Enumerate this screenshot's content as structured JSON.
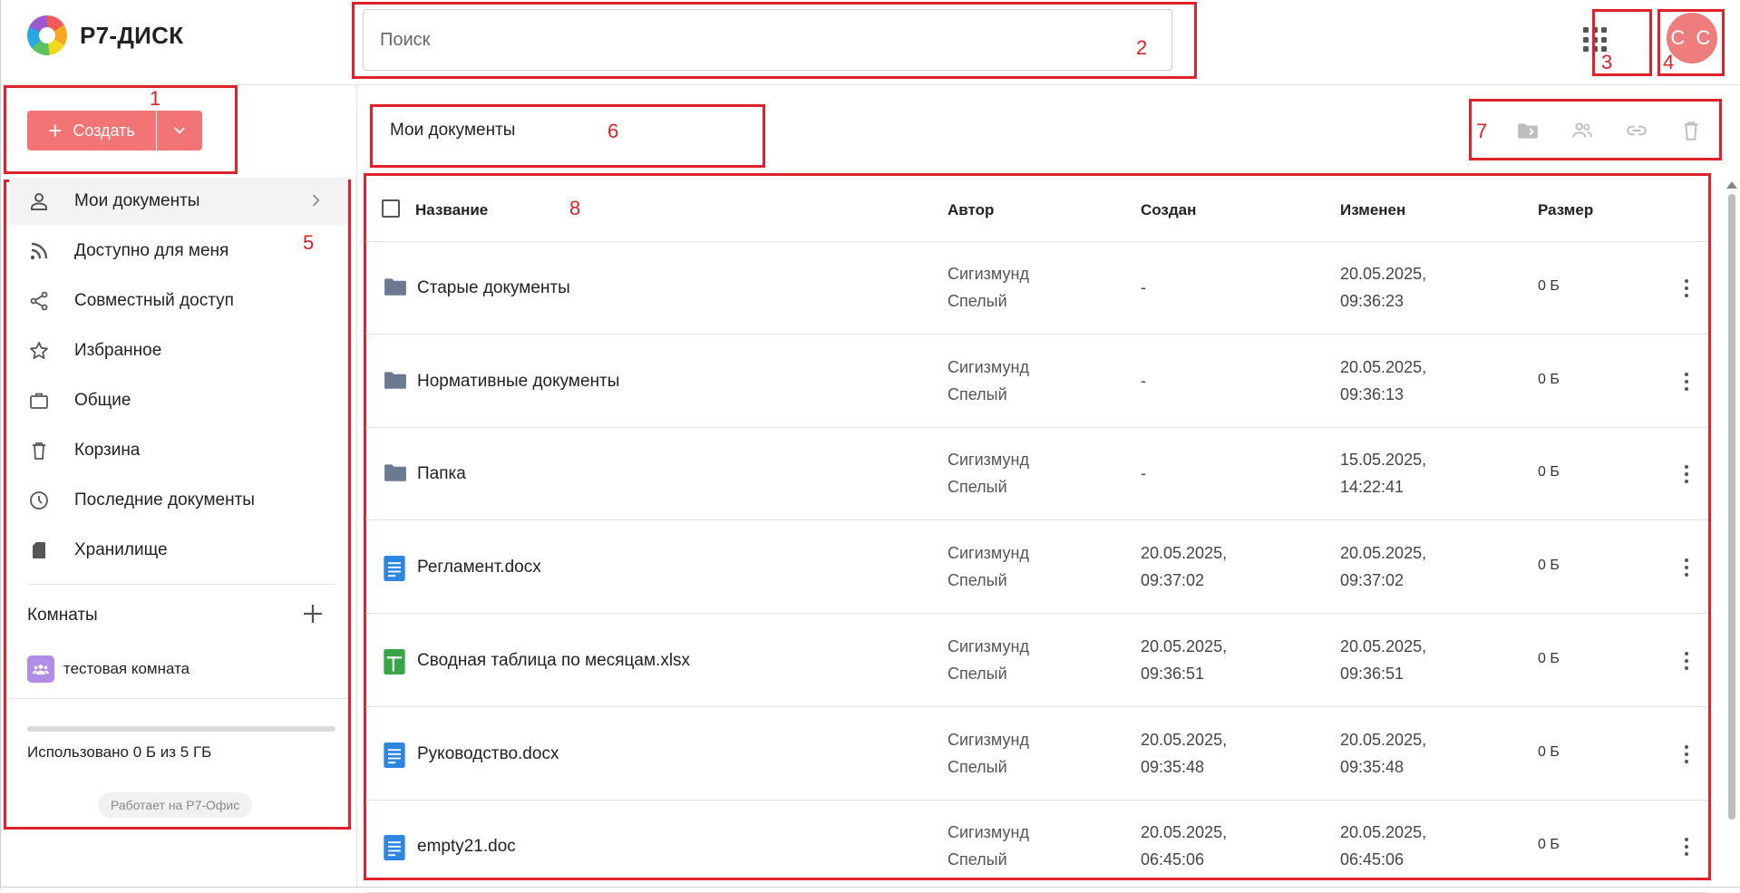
{
  "header": {
    "brand": "Р7-ДИСК",
    "search_placeholder": "Поиск",
    "avatar_initials": "С С",
    "apps_icon": "apps-grid-icon"
  },
  "annotations": [
    "1",
    "2",
    "3",
    "4",
    "5",
    "6",
    "7",
    "8"
  ],
  "create": {
    "label": "Создать"
  },
  "sidebar": {
    "items": [
      {
        "label": "Мои документы",
        "icon": "person-icon"
      },
      {
        "label": "Доступно для меня",
        "icon": "rss-icon"
      },
      {
        "label": "Совместный доступ",
        "icon": "share-icon"
      },
      {
        "label": "Избранное",
        "icon": "star-icon"
      },
      {
        "label": "Общие",
        "icon": "briefcase-icon"
      },
      {
        "label": "Корзина",
        "icon": "trash-icon"
      },
      {
        "label": "Последние документы",
        "icon": "clock-icon"
      },
      {
        "label": "Хранилище",
        "icon": "sd-card-icon"
      }
    ],
    "rooms_title": "Комнаты",
    "rooms": [
      {
        "label": "тестовая комната"
      }
    ],
    "quota": "Использовано 0 Б из 5 ГБ",
    "powered_by": "Работает на Р7-Офис"
  },
  "main": {
    "title": "Мои документы",
    "columns": {
      "name": "Название",
      "author": "Автор",
      "created": "Создан",
      "modified": "Изменен",
      "size": "Размер"
    },
    "rows": [
      {
        "type": "folder",
        "name": "Старые документы",
        "author1": "Сигизмунд",
        "author2": "Спелый",
        "created1": "-",
        "created2": "",
        "modified1": "20.05.2025,",
        "modified2": "09:36:23",
        "size": "0 Б"
      },
      {
        "type": "folder",
        "name": "Нормативные документы",
        "author1": "Сигизмунд",
        "author2": "Спелый",
        "created1": "-",
        "created2": "",
        "modified1": "20.05.2025,",
        "modified2": "09:36:13",
        "size": "0 Б"
      },
      {
        "type": "folder",
        "name": "Папка",
        "author1": "Сигизмунд",
        "author2": "Спелый",
        "created1": "-",
        "created2": "",
        "modified1": "15.05.2025,",
        "modified2": "14:22:41",
        "size": "0 Б"
      },
      {
        "type": "doc",
        "name": "Регламент.docx",
        "author1": "Сигизмунд",
        "author2": "Спелый",
        "created1": "20.05.2025,",
        "created2": "09:37:02",
        "modified1": "20.05.2025,",
        "modified2": "09:37:02",
        "size": "0 Б"
      },
      {
        "type": "sheet",
        "name": "Сводная таблица по месяцам.xlsx",
        "author1": "Сигизмунд",
        "author2": "Спелый",
        "created1": "20.05.2025,",
        "created2": "09:36:51",
        "modified1": "20.05.2025,",
        "modified2": "09:36:51",
        "size": "0 Б"
      },
      {
        "type": "doc",
        "name": "Руководство.docx",
        "author1": "Сигизмунд",
        "author2": "Спелый",
        "created1": "20.05.2025,",
        "created2": "09:35:48",
        "modified1": "20.05.2025,",
        "modified2": "09:35:48",
        "size": "0 Б"
      },
      {
        "type": "doc",
        "name": "empty21.doc",
        "author1": "Сигизмунд",
        "author2": "Спелый",
        "created1": "20.05.2025,",
        "created2": "06:45:06",
        "modified1": "20.05.2025,",
        "modified2": "06:45:06",
        "size": "0 Б"
      }
    ]
  },
  "colors": {
    "accent": "#f27474",
    "annotation": "#e0202a",
    "folder": "#6b7a90",
    "doc": "#2f86e0",
    "sheet": "#3aa547"
  }
}
